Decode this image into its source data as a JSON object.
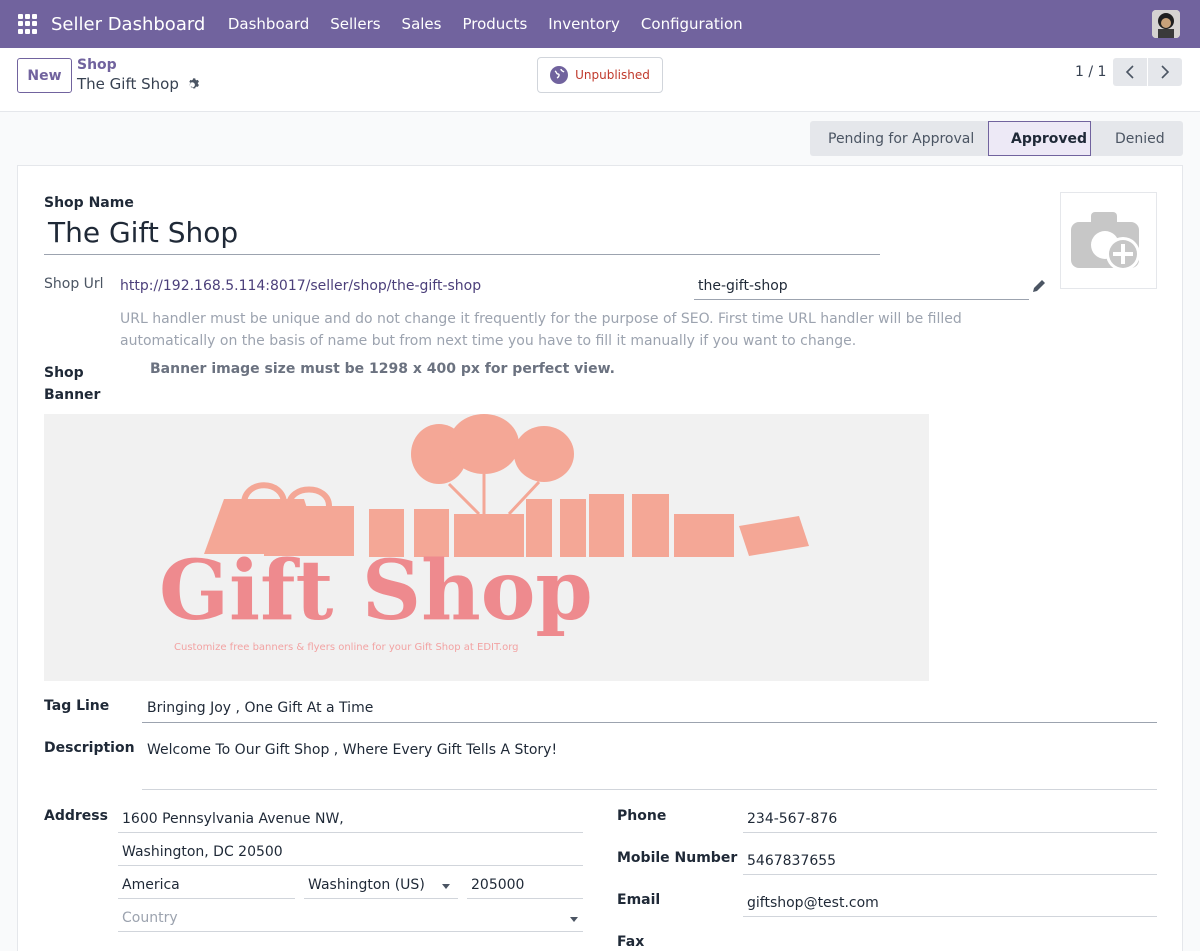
{
  "navbar": {
    "app_title": "Seller Dashboard",
    "menu": [
      "Dashboard",
      "Sellers",
      "Sales",
      "Products",
      "Inventory",
      "Configuration"
    ],
    "accent": "#71639e"
  },
  "control_panel": {
    "new_label": "New",
    "breadcrumb_parent": "Shop",
    "breadcrumb_current": "The Gift Shop",
    "publish_label": "Unpublished",
    "pager": "1 / 1"
  },
  "status": {
    "stages": [
      "Pending for Approval",
      "Approved",
      "Denied"
    ],
    "active": "Approved"
  },
  "form": {
    "shop_name_label": "Shop Name",
    "shop_name": "The Gift Shop",
    "shop_url_label": "Shop Url",
    "shop_url": "http://192.168.5.114:8017/seller/shop/the-gift-shop",
    "url_slug": "the-gift-shop",
    "url_help": "URL handler must be unique and do not change it frequently for the purpose of SEO. First time URL handler will be filled automatically on the basis of name but from next time you have to fill it manually if you want to change.",
    "banner_label": "Shop Banner",
    "banner_help": "Banner image size must be 1298 x 400 px for perfect view.",
    "banner_title": "Gift Shop",
    "banner_caption": "Customize free banners & flyers online for your Gift Shop at EDIT.org",
    "tag_line_label": "Tag Line",
    "tag_line": "Bringing Joy , One Gift At a Time",
    "description_label": "Description",
    "description": "Welcome To Our Gift Shop , Where Every Gift Tells A Story!",
    "address_label": "Address",
    "street": "1600 Pennsylvania Avenue NW,",
    "street2": "Washington, DC 20500",
    "city": "America",
    "state": "Washington (US)",
    "zip": "205000",
    "country_placeholder": "Country",
    "phone_label": "Phone",
    "phone": "234-567-876",
    "mobile_label": "Mobile Number",
    "mobile": "5467837655",
    "email_label": "Email",
    "email": "giftshop@test.com",
    "fax_label": "Fax"
  }
}
